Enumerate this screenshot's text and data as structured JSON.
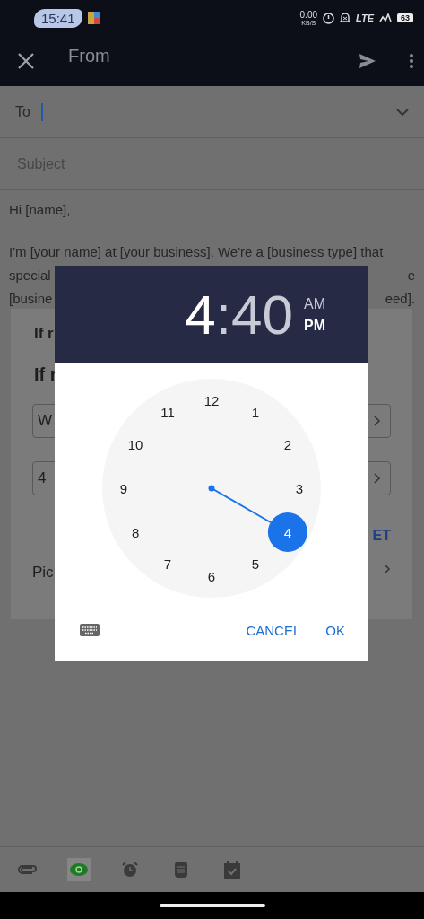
{
  "status_bar": {
    "time": "15:41",
    "speed": "0.00",
    "speed_unit": "KB/S",
    "network": "LTE",
    "battery": "63"
  },
  "app_bar": {
    "title": "From"
  },
  "compose": {
    "to_label": "To",
    "subject_placeholder": "Subject",
    "body_paragraphs": [
      [
        {
          "left": "Hi [name],"
        }
      ],
      [
        {
          "left": "I'm [your name] at [your business]. We're a [business type] that"
        },
        {
          "left": "special",
          "right": "e"
        },
        {
          "left": "[busine",
          "right": "eed]."
        }
      ]
    ]
  },
  "sheet": {
    "title": "If r",
    "heading": "If r",
    "fields": [
      "W",
      "4"
    ],
    "action": "ET",
    "row": "Pic"
  },
  "time_picker": {
    "hour": {
      "text": "4",
      "selected": true
    },
    "separator": ":",
    "minute": {
      "text": "40",
      "selected": false
    },
    "periods": [
      {
        "label": "AM",
        "selected": false
      },
      {
        "label": "PM",
        "selected": true
      }
    ],
    "dial": [
      {
        "label": "12",
        "selected": false
      },
      {
        "label": "1",
        "selected": false
      },
      {
        "label": "2",
        "selected": false
      },
      {
        "label": "3",
        "selected": false
      },
      {
        "label": "4",
        "selected": true
      },
      {
        "label": "5",
        "selected": false
      },
      {
        "label": "6",
        "selected": false
      },
      {
        "label": "7",
        "selected": false
      },
      {
        "label": "8",
        "selected": false
      },
      {
        "label": "9",
        "selected": false
      },
      {
        "label": "10",
        "selected": false
      },
      {
        "label": "11",
        "selected": false
      }
    ],
    "buttons": [
      "CANCEL",
      "OK"
    ]
  },
  "toolbar": [
    {
      "kind": "attach",
      "selected": false
    },
    {
      "kind": "eye",
      "selected": true
    },
    {
      "kind": "alarm",
      "selected": false
    },
    {
      "kind": "notes",
      "selected": false
    },
    {
      "kind": "calendar",
      "selected": false
    }
  ]
}
